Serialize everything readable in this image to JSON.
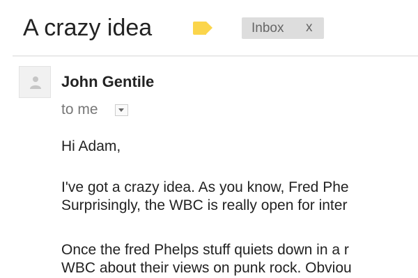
{
  "thread": {
    "subject": "A crazy idea",
    "label_color": "#fbd54b",
    "inbox_label": "Inbox",
    "inbox_remove": "x"
  },
  "message": {
    "sender": "John Gentile",
    "avatar_icon": "person-icon",
    "recipients": "to me",
    "details_icon": "chevron-down-icon",
    "body": {
      "greeting": "Hi Adam,",
      "paragraph1_line1": "I've got a crazy idea. As you know, Fred Phe",
      "paragraph1_line2": "Surprisingly, the WBC is really open for inter",
      "paragraph2_line1": "Once the fred Phelps stuff quiets down in a r",
      "paragraph2_line2": "WBC about their views on punk rock. Obviou"
    }
  }
}
